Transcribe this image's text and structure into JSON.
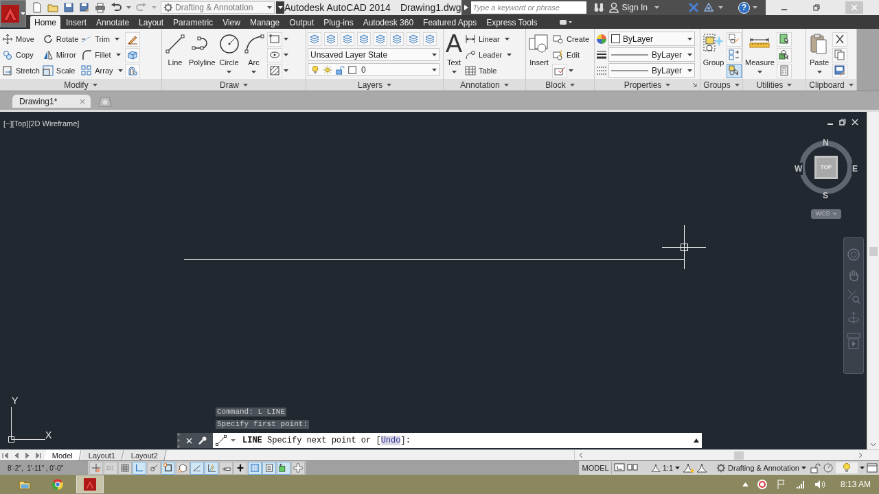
{
  "title_bar": {
    "workspace": "Drafting & Annotation",
    "app_name": "Autodesk AutoCAD 2014",
    "document": "Drawing1.dwg",
    "search": {
      "placeholder": "Type a keyword or phrase"
    },
    "sign_in": "Sign In",
    "help": "?"
  },
  "ribbon_tabs": [
    {
      "label": "Home",
      "selected": true
    },
    {
      "label": "Insert",
      "selected": false
    },
    {
      "label": "Annotate",
      "selected": false
    },
    {
      "label": "Layout",
      "selected": false
    },
    {
      "label": "Parametric",
      "selected": false
    },
    {
      "label": "View",
      "selected": false
    },
    {
      "label": "Manage",
      "selected": false
    },
    {
      "label": "Output",
      "selected": false
    },
    {
      "label": "Plug-ins",
      "selected": false
    },
    {
      "label": "Autodesk 360",
      "selected": false
    },
    {
      "label": "Featured Apps",
      "selected": false
    },
    {
      "label": "Express Tools",
      "selected": false
    }
  ],
  "ribbon_panels": [
    {
      "title": "Modify",
      "columns": [
        [
          {
            "kind": "small",
            "label": "Move"
          },
          {
            "kind": "small",
            "label": "Copy"
          },
          {
            "kind": "small",
            "label": "Stretch"
          }
        ],
        [
          {
            "kind": "small",
            "label": "Rotate"
          },
          {
            "kind": "small",
            "label": "Mirror"
          },
          {
            "kind": "small",
            "label": "Scale"
          }
        ],
        [
          {
            "kind": "small",
            "label": "Trim",
            "caret": true
          },
          {
            "kind": "small",
            "label": "Fillet",
            "caret": true
          },
          {
            "kind": "small",
            "label": "Array",
            "caret": true
          }
        ],
        [
          {
            "kind": "icon"
          },
          {
            "kind": "icon"
          },
          {
            "kind": "icon"
          }
        ]
      ]
    },
    {
      "title": "Draw",
      "columns": [
        [
          {
            "kind": "large",
            "label": "Line"
          }
        ],
        [
          {
            "kind": "large",
            "label": "Polyline"
          }
        ],
        [
          {
            "kind": "large",
            "label": "Circle",
            "caret": true
          }
        ],
        [
          {
            "kind": "large",
            "label": "Arc",
            "caret": true
          }
        ],
        [
          {
            "kind": "icon",
            "caret": true
          },
          {
            "kind": "icon",
            "caret": true
          },
          {
            "kind": "icon",
            "caret": true
          }
        ]
      ]
    },
    {
      "title": "Layers",
      "columns": [
        [
          {
            "kind": "icon_row"
          },
          {
            "kind": "dropdown",
            "value": "Unsaved Layer State"
          },
          {
            "kind": "layer",
            "value": "0"
          }
        ]
      ]
    },
    {
      "title": "Annotation",
      "columns": [
        [
          {
            "kind": "large",
            "glyph": "A",
            "label": "Text",
            "caret": true
          }
        ],
        [
          {
            "kind": "small",
            "label": "Linear",
            "caret": true
          },
          {
            "kind": "small",
            "label": "Leader",
            "caret": true
          },
          {
            "kind": "small",
            "label": "Table"
          }
        ]
      ]
    },
    {
      "title": "Block",
      "columns": [
        [
          {
            "kind": "large",
            "label": "Insert"
          }
        ],
        [
          {
            "kind": "small",
            "label": "Create"
          },
          {
            "kind": "small",
            "label": "Edit"
          },
          {
            "kind": "icon",
            "caret": true
          }
        ]
      ]
    },
    {
      "title": "Properties",
      "launcher": true,
      "columns": [
        [
          {
            "kind": "plain_icon"
          },
          {
            "kind": "plain_icon"
          },
          {
            "kind": "plain_icon"
          }
        ],
        [
          {
            "kind": "color",
            "value": "ByLayer"
          },
          {
            "kind": "linetype",
            "value": "ByLayer"
          },
          {
            "kind": "lineweight",
            "value": "ByLayer"
          }
        ]
      ]
    },
    {
      "title": "Groups",
      "columns": [
        [
          {
            "kind": "large",
            "label": "Group"
          }
        ],
        [
          {
            "kind": "icon",
            "on": false
          },
          {
            "kind": "icon",
            "on": false
          },
          {
            "kind": "icon",
            "on": true
          }
        ]
      ]
    },
    {
      "title": "Utilities",
      "columns": [
        [
          {
            "kind": "large",
            "label": "Measure",
            "caret": true
          }
        ],
        [
          {
            "kind": "icon"
          },
          {
            "kind": "icon"
          },
          {
            "kind": "icon"
          }
        ]
      ]
    },
    {
      "title": "Clipboard",
      "columns": [
        [
          {
            "kind": "large",
            "label": "Paste",
            "caret": true
          }
        ],
        [
          {
            "kind": "icon"
          },
          {
            "kind": "icon"
          },
          {
            "kind": "icon"
          }
        ]
      ]
    }
  ],
  "file_tabs": [
    {
      "label": "Drawing1*",
      "selected": true
    }
  ],
  "viewport": {
    "label": "[−][Top][2D Wireframe]",
    "view_cube": {
      "top": "TOP",
      "north": "N",
      "south": "S",
      "east": "E",
      "west": "W",
      "ucs_menu": "WCS"
    },
    "ucs_icon": {
      "x": "X",
      "y": "Y"
    }
  },
  "command_line": {
    "history": [
      "Command: L LINE",
      "Specify first point:"
    ],
    "command": "LINE",
    "prompt": "Specify next point or [",
    "option": "Undo",
    "prompt_end": "]:"
  },
  "layout_tabs": [
    {
      "label": "Model",
      "selected": true
    },
    {
      "label": "Layout1",
      "selected": false
    },
    {
      "label": "Layout2",
      "selected": false
    }
  ],
  "status_bar": {
    "coordinates": "8'-2\",  1'-11\" , 0'-0\"",
    "toggles": [
      {
        "on": false
      },
      {
        "on": false
      },
      {
        "on": false
      },
      {
        "on": true
      },
      {
        "on": false
      },
      {
        "on": true
      },
      {
        "on": false
      },
      {
        "on": true
      },
      {
        "on": true
      },
      {
        "on": false
      },
      {
        "on": false
      },
      {
        "on": true
      },
      {
        "on": true
      },
      {
        "on": true
      },
      {
        "on": false
      }
    ],
    "space": "MODEL",
    "annotation_scale": "1:1",
    "workspace": "Drafting & Annotation"
  },
  "taskbar": {
    "time": "8:13 AM"
  }
}
